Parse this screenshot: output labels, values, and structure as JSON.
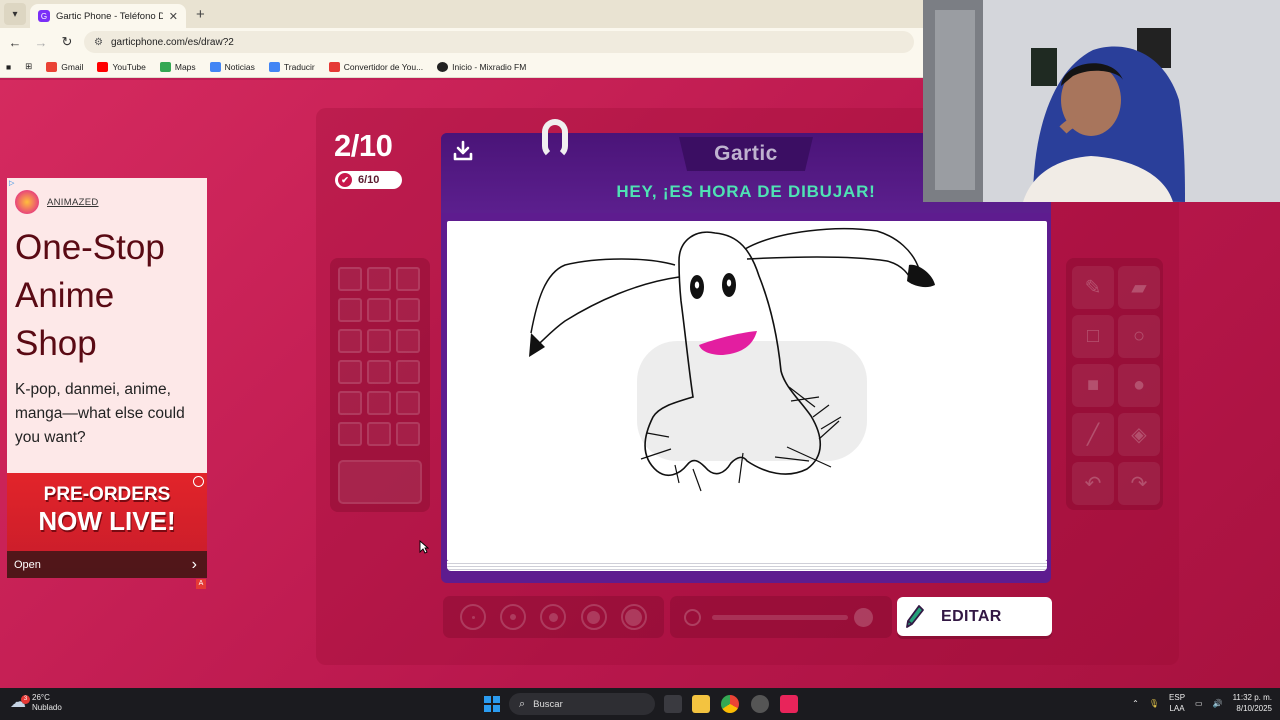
{
  "browser": {
    "tab_title": "Gartic Phone - Teléfono Descon",
    "tab_favicon": "G",
    "url": "garticphone.com/es/draw?2",
    "bookmarks": [
      {
        "label": "Gmail",
        "color": "#ea4335"
      },
      {
        "label": "YouTube",
        "color": "#ff0000"
      },
      {
        "label": "Maps",
        "color": "#34a853"
      },
      {
        "label": "Noticias",
        "color": "#4285f4"
      },
      {
        "label": "Traducir",
        "color": "#4285f4"
      },
      {
        "label": "Convertidor de You...",
        "color": "#e53935"
      },
      {
        "label": "Inicio - Mixradio FM",
        "color": "#222222"
      }
    ]
  },
  "ad": {
    "adchoices": "▷",
    "brand": "ANIMAZED",
    "headline": "One-Stop Anime Shop",
    "body": "K-pop, danmei, anime, manga—what else could you want?",
    "banner_line1": "PRE-ORDERS",
    "banner_line2": "NOW LIVE!",
    "open_label": "Open",
    "open_arrow": "›",
    "corner_badge": "A"
  },
  "game": {
    "round": "2/10",
    "done_count": "6/10",
    "logo_text": "Gartic",
    "prompt": "HEY, ¡ES HORA DE DIBUJAR!",
    "edit_button": "EDITAR",
    "accent_color": "#4fe2b4",
    "palette_slots": 18,
    "tools": [
      "pencil-icon",
      "eraser-icon",
      "rectangle-outline-icon",
      "circle-outline-icon",
      "rectangle-fill-icon",
      "circle-fill-icon",
      "line-icon",
      "fill-bucket-icon",
      "undo-icon",
      "redo-icon"
    ],
    "brush_sizes": [
      "xs",
      "s",
      "m",
      "l",
      "xl"
    ]
  },
  "taskbar": {
    "temperature": "26°C",
    "weather": "Nublado",
    "weather_badge": "3",
    "search_placeholder": "Buscar",
    "language": "ESP",
    "language_sub": "LAA",
    "time": "11:32 p. m.",
    "date": "8/10/2025"
  }
}
